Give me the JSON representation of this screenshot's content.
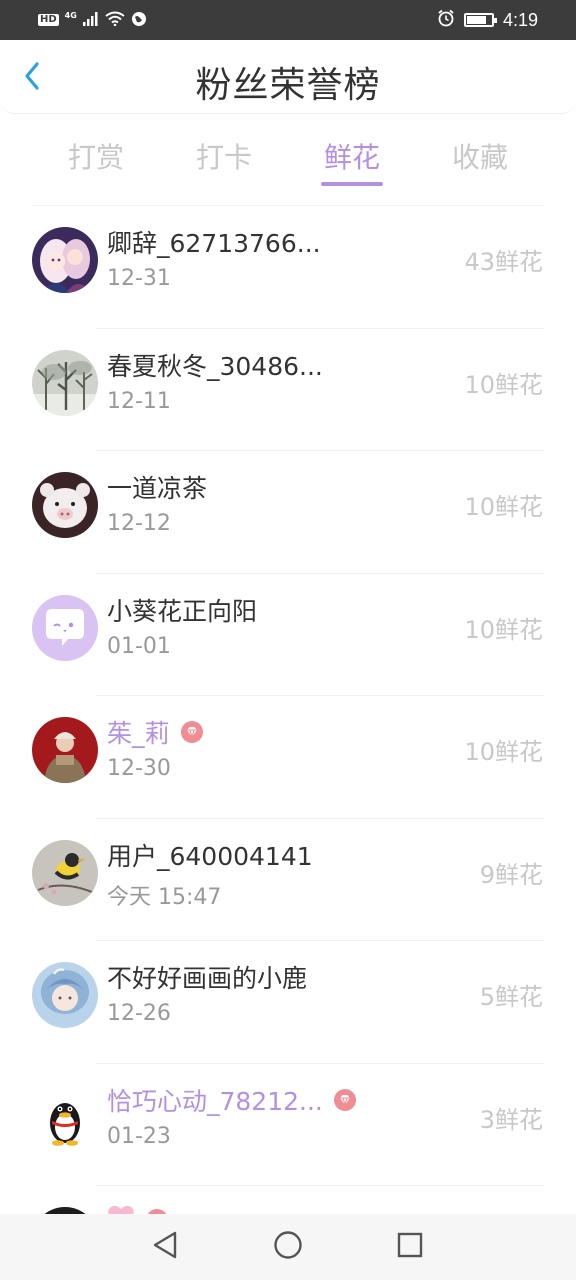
{
  "status_bar": {
    "hd": "HD",
    "network": "4G",
    "time": "4:19",
    "battery_level": 0.75
  },
  "header": {
    "title": "粉丝荣誉榜"
  },
  "tabs": [
    {
      "label": "打赏",
      "active": false
    },
    {
      "label": "打卡",
      "active": false
    },
    {
      "label": "鲜花",
      "active": true
    },
    {
      "label": "收藏",
      "active": false
    }
  ],
  "colors": {
    "accent": "#b490e4",
    "text": "#333333",
    "muted": "#999999",
    "count": "#c8c8c8",
    "vip": "#f08c94"
  },
  "fans": [
    {
      "name": "卿辞_62713766...",
      "date": "12-31",
      "count": "43鲜花",
      "vip": false,
      "avatar": "anime-girl-avatar"
    },
    {
      "name": "春夏秋冬_30486...",
      "date": "12-11",
      "count": "10鲜花",
      "vip": false,
      "avatar": "winter-trees-avatar"
    },
    {
      "name": "一道凉茶",
      "date": "12-12",
      "count": "10鲜花",
      "vip": false,
      "avatar": "white-pig-avatar"
    },
    {
      "name": "小葵花正向阳",
      "date": "01-01",
      "count": "10鲜花",
      "vip": false,
      "avatar": "default-chat-avatar"
    },
    {
      "name": "茱_莉",
      "date": "12-30",
      "count": "10鲜花",
      "vip": true,
      "avatar": "person-red-bg-avatar"
    },
    {
      "name": "用户_640004141",
      "date": "今天 15:47",
      "count": "9鲜花",
      "vip": false,
      "avatar": "bird-avatar"
    },
    {
      "name": "不好好画画的小鹿",
      "date": "12-26",
      "count": "5鲜花",
      "vip": false,
      "avatar": "blue-hair-anime-avatar"
    },
    {
      "name": "恰巧心动_78212...",
      "date": "01-23",
      "count": "3鲜花",
      "vip": true,
      "avatar": "penguin-avatar"
    }
  ],
  "nav": {
    "back": "back-triangle-icon",
    "home": "home-circle-icon",
    "recent": "recent-square-icon"
  }
}
